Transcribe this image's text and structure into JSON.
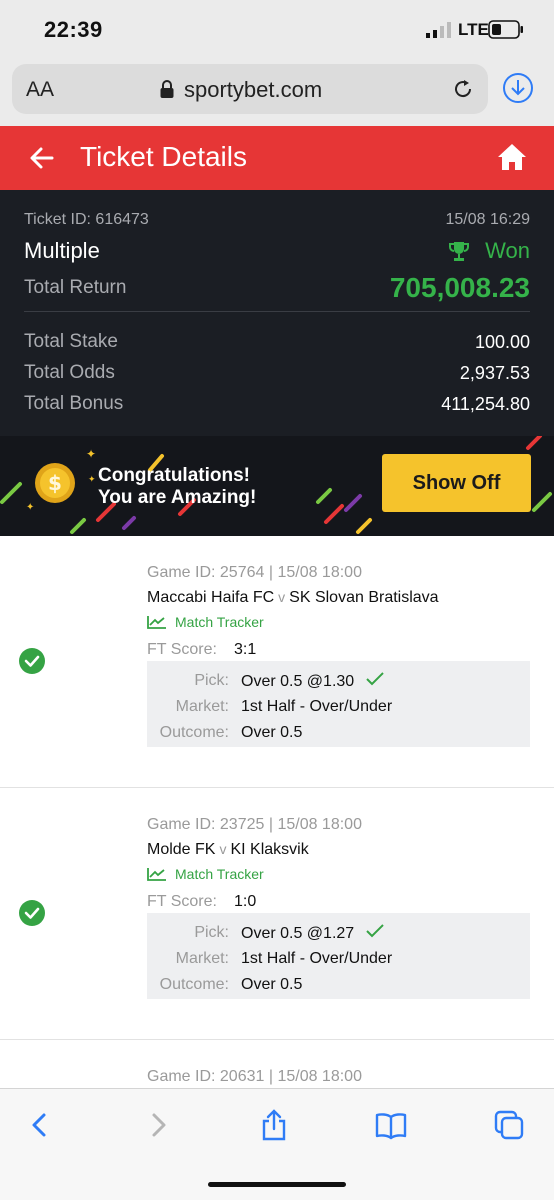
{
  "status_bar": {
    "time": "22:39",
    "network": "LTE"
  },
  "browser": {
    "text_size_label": "AA",
    "domain": "sportybet.com"
  },
  "header": {
    "title": "Ticket Details"
  },
  "ticket": {
    "id_label": "Ticket ID: 616473",
    "date": "15/08 16:29",
    "type": "Multiple",
    "status": "Won",
    "total_return_label": "Total Return",
    "total_return": "705,008.23",
    "rows": [
      {
        "label": "Total Stake",
        "value": "100.00"
      },
      {
        "label": "Total Odds",
        "value": "2,937.53"
      },
      {
        "label": "Total Bonus",
        "value": "411,254.80"
      }
    ]
  },
  "promo": {
    "line1": "Congratulations!",
    "line2": "You are Amazing!",
    "button": "Show Off"
  },
  "bets": [
    {
      "game_id": "Game ID: 25764 | 15/08 18:00",
      "home": "Maccabi Haifa FC",
      "vs": "v",
      "away": "SK Slovan Bratislava",
      "tracker": "Match Tracker",
      "ft_label": "FT Score:",
      "ft_score": "3:1",
      "pick_label": "Pick:",
      "pick": "Over 0.5 @1.30",
      "market_label": "Market:",
      "market": "1st Half - Over/Under",
      "outcome_label": "Outcome:",
      "outcome": "Over 0.5"
    },
    {
      "game_id": "Game ID: 23725 | 15/08 18:00",
      "home": "Molde FK",
      "vs": "v",
      "away": "KI Klaksvik",
      "tracker": "Match Tracker",
      "ft_label": "FT Score:",
      "ft_score": "1:0",
      "pick_label": "Pick:",
      "pick": "Over 0.5 @1.27",
      "market_label": "Market:",
      "market": "1st Half - Over/Under",
      "outcome_label": "Outcome:",
      "outcome": "Over 0.5"
    },
    {
      "game_id": "Game ID: 20631 | 15/08 18:00"
    }
  ],
  "colors": {
    "header_red": "#e63636",
    "win_green": "#35b34a",
    "button_yellow": "#f5c32c",
    "ios_blue": "#2f7cf6"
  }
}
